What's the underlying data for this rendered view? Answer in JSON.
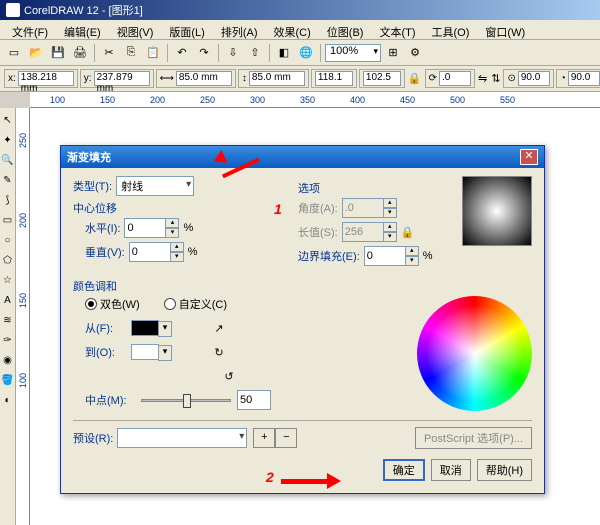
{
  "app_title": "CorelDRAW 12 - [图形1]",
  "menus": [
    "文件(F)",
    "编辑(E)",
    "视图(V)",
    "版面(L)",
    "排列(A)",
    "效果(C)",
    "位图(B)",
    "文本(T)",
    "工具(O)",
    "窗口(W)"
  ],
  "zoom": "100%",
  "coords": {
    "x": "138.218 mm",
    "y": "237.879 mm",
    "w": "85.0 mm",
    "h": "85.0 mm",
    "sx": "118.1",
    "sy": "102.5",
    "rot1": ".0",
    "rot2": ".0",
    "r3": "90.0",
    "r4": "90.0"
  },
  "ruler_h": [
    "100",
    "150",
    "200",
    "250",
    "300",
    "350",
    "400",
    "450",
    "500",
    "550"
  ],
  "ruler_v": [
    "250",
    "200",
    "150",
    "100"
  ],
  "dialog": {
    "title": "渐变填充",
    "type_label": "类型(T):",
    "type_value": "射线",
    "options_title": "选项",
    "angle_label": "角度(A):",
    "angle_val": ".0",
    "steps_label": "长值(S):",
    "steps_val": "256",
    "edge_label": "边界填充(E):",
    "edge_val": "0",
    "center_title": "中心位移",
    "horiz_label": "水平(I):",
    "horiz_val": "0",
    "vert_label": "垂直(V):",
    "vert_val": "0",
    "pct": "%",
    "blend_title": "颜色调和",
    "two_color": "双色(W)",
    "custom": "自定义(C)",
    "from_label": "从(F):",
    "to_label": "到(O):",
    "mid_label": "中点(M):",
    "mid_val": "50",
    "preset_label": "预设(R):",
    "ps_btn": "PostScript 选项(P)...",
    "ok": "确定",
    "cancel": "取消",
    "help": "帮助(H)",
    "callout1": "1",
    "callout2": "2"
  }
}
